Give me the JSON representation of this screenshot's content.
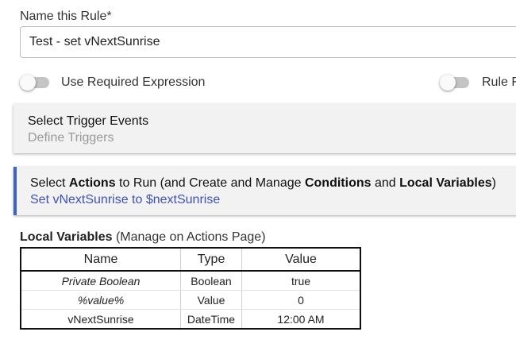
{
  "rule_name": {
    "label": "Name this Rule*",
    "value": "Test - set vNextSunrise"
  },
  "toggles": {
    "required_expression": {
      "label": "Use Required Expression",
      "on": false
    },
    "rule_f": {
      "label": "Rule F",
      "on": false
    }
  },
  "trigger_panel": {
    "title": "Select Trigger Events",
    "subtitle": "Define Triggers"
  },
  "actions_panel": {
    "title_part1": "Select ",
    "title_actions": "Actions",
    "title_part2": " to Run (and Create and Manage ",
    "title_conditions": "Conditions",
    "title_part3": " and ",
    "title_local_vars": "Local Variables",
    "title_part4": ")",
    "subtitle": "Set vNextSunrise to $nextSunrise",
    "accent_color": "#3f64c0"
  },
  "local_variables": {
    "heading_bold": "Local Variables",
    "heading_rest": " (Manage on Actions Page)",
    "columns": [
      "Name",
      "Type",
      "Value"
    ],
    "rows": [
      {
        "name": "Private Boolean",
        "type": "Boolean",
        "value": "true"
      },
      {
        "name": "%value%",
        "type": "Value",
        "value": "0"
      },
      {
        "name": "vNextSunrise",
        "type": "DateTime",
        "value": "12:00 AM"
      }
    ]
  }
}
